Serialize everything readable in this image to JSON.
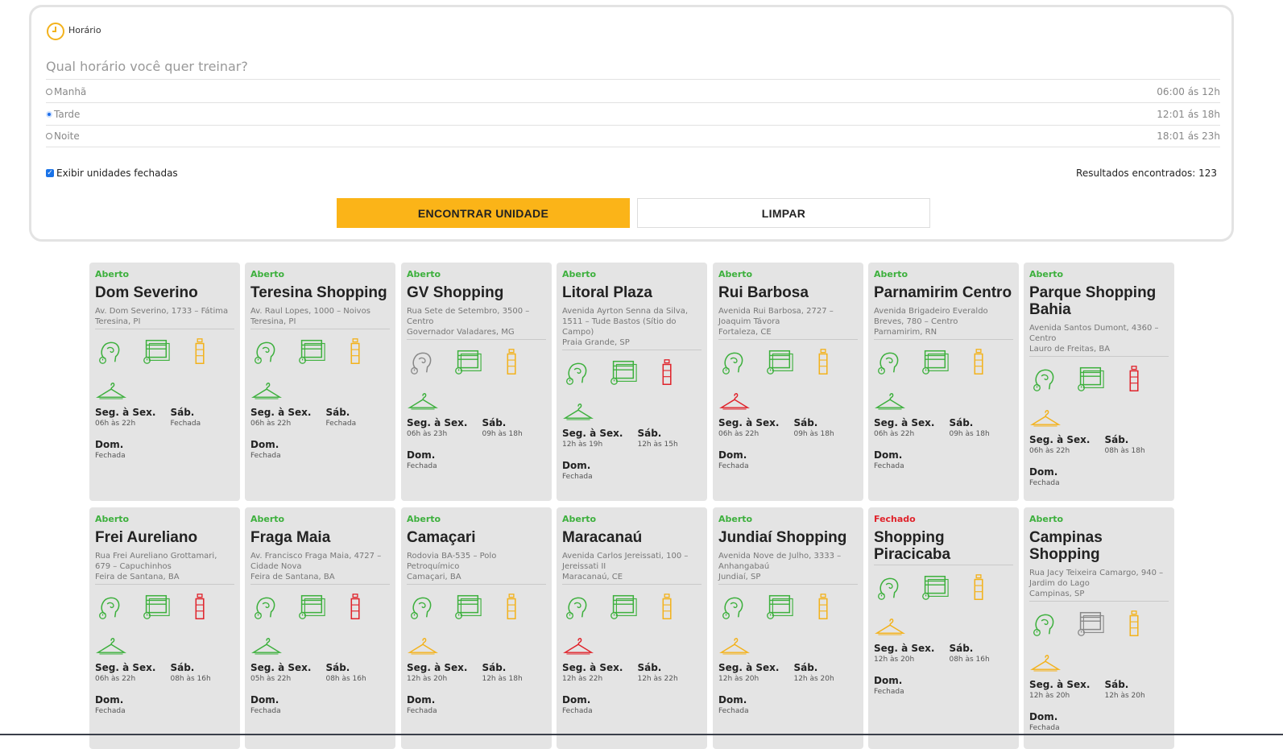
{
  "filter": {
    "section_label": "Horário",
    "question": "Qual horário você quer treinar?",
    "periods": [
      {
        "label": "Manhã",
        "hours": "06:00 ás 12h",
        "selected": false
      },
      {
        "label": "Tarde",
        "hours": "12:01 ás 18h",
        "selected": true
      },
      {
        "label": "Noite",
        "hours": "18:01 ás 23h",
        "selected": false
      }
    ],
    "show_closed_label": "Exibir unidades fechadas",
    "results_label": "Resultados encontrados: 123",
    "find_button": "ENCONTRAR UNIDADE",
    "clear_button": "LIMPAR"
  },
  "labels": {
    "weekdays": "Seg. à Sex.",
    "saturday": "Sáb.",
    "sunday": "Dom."
  },
  "colors": {
    "accent": "#fbb418",
    "green": "#3db03d",
    "yellow": "#f3b21c",
    "red": "#e0232b",
    "gray": "#888888"
  },
  "units": [
    {
      "status": "Aberto",
      "name": "Dom Severino",
      "addr1": "Av. Dom Severino, 1733 – Fátima",
      "addr2": "Teresina, PI",
      "icons": [
        "green",
        "green",
        "yellow",
        "green"
      ],
      "wk": "06h às 22h",
      "sat": "Fechada",
      "sun": "Fechada"
    },
    {
      "status": "Aberto",
      "name": "Teresina Shopping",
      "addr1": "Av. Raul Lopes, 1000 – Noivos",
      "addr2": "Teresina, PI",
      "icons": [
        "green",
        "green",
        "yellow",
        "green"
      ],
      "wk": "06h às 22h",
      "sat": "Fechada",
      "sun": "Fechada"
    },
    {
      "status": "Aberto",
      "name": "GV Shopping",
      "addr1": "Rua Sete de Setembro, 3500 – Centro",
      "addr2": "Governador Valadares, MG",
      "icons": [
        "gray",
        "green",
        "yellow",
        "green"
      ],
      "wk": "06h às 23h",
      "sat": "09h às 18h",
      "sun": "Fechada"
    },
    {
      "status": "Aberto",
      "name": "Litoral Plaza",
      "addr1": "Avenida Ayrton Senna da Silva, 1511 – Tude Bastos (Sítio do Campo)",
      "addr2": "Praia Grande, SP",
      "icons": [
        "green",
        "green",
        "red",
        "green"
      ],
      "wk": "12h às 19h",
      "sat": "12h às 15h",
      "sun": "Fechada"
    },
    {
      "status": "Aberto",
      "name": "Rui Barbosa",
      "addr1": "Avenida Rui Barbosa, 2727 – Joaquim Távora",
      "addr2": "Fortaleza, CE",
      "icons": [
        "green",
        "green",
        "yellow",
        "red"
      ],
      "wk": "06h às 22h",
      "sat": "09h às 18h",
      "sun": "Fechada"
    },
    {
      "status": "Aberto",
      "name": "Parnamirim Centro",
      "addr1": "Avenida Brigadeiro Everaldo Breves, 780 – Centro",
      "addr2": "Parnamirim, RN",
      "icons": [
        "green",
        "green",
        "yellow",
        "green"
      ],
      "wk": "06h às 22h",
      "sat": "09h às 18h",
      "sun": "Fechada"
    },
    {
      "status": "Aberto",
      "name": "Parque Shopping Bahia",
      "addr1": "Avenida Santos Dumont, 4360 – Centro",
      "addr2": "Lauro de Freitas, BA",
      "icons": [
        "green",
        "green",
        "red",
        "yellow"
      ],
      "wk": "06h às 22h",
      "sat": "08h às 18h",
      "sun": "Fechada"
    },
    {
      "status": "Aberto",
      "name": "Frei Aureliano",
      "addr1": "Rua Frei Aureliano Grottamari, 679 – Capuchinhos",
      "addr2": "Feira de Santana, BA",
      "icons": [
        "green",
        "green",
        "red",
        "green"
      ],
      "wk": "06h às 22h",
      "sat": "08h às 16h",
      "sun": "Fechada"
    },
    {
      "status": "Aberto",
      "name": "Fraga Maia",
      "addr1": "Av. Francisco Fraga Maia, 4727 – Cidade Nova",
      "addr2": "Feira de Santana, BA",
      "icons": [
        "green",
        "green",
        "red",
        "green"
      ],
      "wk": "05h às 22h",
      "sat": "08h às 16h",
      "sun": "Fechada"
    },
    {
      "status": "Aberto",
      "name": "Camaçari",
      "addr1": "Rodovia BA-535 – Polo Petroquímico",
      "addr2": "Camaçari, BA",
      "icons": [
        "green",
        "green",
        "yellow",
        "yellow"
      ],
      "wk": "12h às 20h",
      "sat": "12h às 18h",
      "sun": "Fechada"
    },
    {
      "status": "Aberto",
      "name": "Maracanaú",
      "addr1": "Avenida Carlos Jereissati, 100 – Jereissati II",
      "addr2": "Maracanaú, CE",
      "icons": [
        "green",
        "green",
        "yellow",
        "red"
      ],
      "wk": "12h às 22h",
      "sat": "12h às 22h",
      "sun": "Fechada"
    },
    {
      "status": "Aberto",
      "name": "Jundiaí Shopping",
      "addr1": "Avenida Nove de Julho, 3333 – Anhangabaú",
      "addr2": "Jundiaí, SP",
      "icons": [
        "green",
        "green",
        "yellow",
        "yellow"
      ],
      "wk": "12h às 20h",
      "sat": "12h às 20h",
      "sun": "Fechada"
    },
    {
      "status": "Fechado",
      "name": "Shopping Piracicaba",
      "addr1": "",
      "addr2": "",
      "icons": [
        "green",
        "green",
        "yellow",
        "yellow"
      ],
      "wk": "12h às 20h",
      "sat": "08h às 16h",
      "sun": "Fechada"
    },
    {
      "status": "Aberto",
      "name": "Campinas Shopping",
      "addr1": "Rua Jacy Teixeira Camargo, 940 – Jardim do Lago",
      "addr2": "Campinas, SP",
      "icons": [
        "green",
        "gray",
        "yellow",
        "yellow"
      ],
      "wk": "12h às 20h",
      "sat": "12h às 20h",
      "sun": "Fechada"
    }
  ]
}
